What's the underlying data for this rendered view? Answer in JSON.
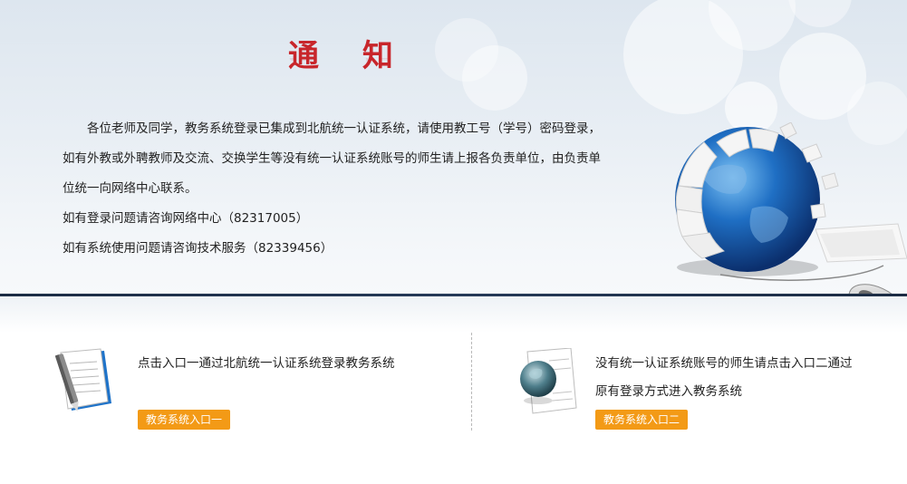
{
  "notice": {
    "title": "通 知",
    "paragraph1": "各位老师及同学，教务系统登录已集成到北航统一认证系统，请使用教工号（学号）密码登录，如有外教或外聘教师及交流、交换学生等没有统一认证系统账号的师生请上报各负责单位，由负责单位统一向网络中心联系。",
    "line_network": "如有登录问题请咨询网络中心（82317005）",
    "line_support": "如有系统使用问题请咨询技术服务（82339456）"
  },
  "entry1": {
    "text": "点击入口一通过北航统一认证系统登录教务系统",
    "button": "教务系统入口一",
    "icon": "document-pen-icon"
  },
  "entry2": {
    "text": "没有统一认证系统账号的师生请点击入口二通过原有登录方式进入教务系统",
    "button": "教务系统入口二",
    "icon": "globe-document-icon"
  },
  "colors": {
    "title": "#c8262b",
    "button": "#f39a16",
    "divider": "#1c2c44"
  }
}
